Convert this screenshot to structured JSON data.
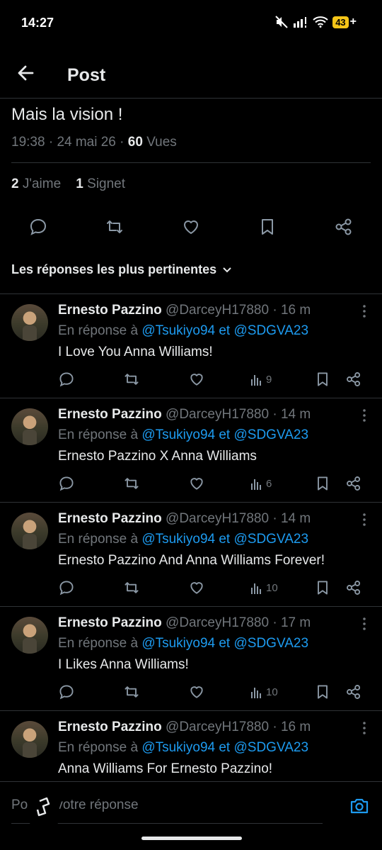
{
  "status_bar": {
    "time": "14:27",
    "battery": "43",
    "battery_plus": "+"
  },
  "header": {
    "title": "Post"
  },
  "post": {
    "text": "Mais la vision !",
    "time": "19:38",
    "date": "24 mai 26",
    "views_count": "60",
    "views_label": "Vues",
    "likes_count": "2",
    "likes_label": "J'aime",
    "bookmarks_count": "1",
    "bookmarks_label": "Signet"
  },
  "sort": {
    "label": "Les réponses les plus pertinentes"
  },
  "replies": [
    {
      "name": "Ernesto Pazzino",
      "handle": "@DarceyH17880",
      "time": "16 m",
      "reply_prefix": "En réponse à",
      "mentions": "@Tsukiyo94 et @SDGVA23",
      "text": "I Love You Anna Williams!",
      "views": "9"
    },
    {
      "name": "Ernesto Pazzino",
      "handle": "@DarceyH17880",
      "time": "14 m",
      "reply_prefix": "En réponse à",
      "mentions": "@Tsukiyo94 et @SDGVA23",
      "text": "Ernesto Pazzino X Anna Williams",
      "views": "6"
    },
    {
      "name": "Ernesto Pazzino",
      "handle": "@DarceyH17880",
      "time": "14 m",
      "reply_prefix": "En réponse à",
      "mentions": "@Tsukiyo94 et @SDGVA23",
      "text": "Ernesto Pazzino And Anna Williams Forever!",
      "views": "10"
    },
    {
      "name": "Ernesto Pazzino",
      "handle": "@DarceyH17880",
      "time": "17 m",
      "reply_prefix": "En réponse à",
      "mentions": "@Tsukiyo94 et @SDGVA23",
      "text": "I Likes Anna Williams!",
      "views": "10"
    },
    {
      "name": "Ernesto Pazzino",
      "handle": "@DarceyH17880",
      "time": "16 m",
      "reply_prefix": "En réponse à",
      "mentions": "@Tsukiyo94 et @SDGVA23",
      "text": "Anna Williams For Ernesto Pazzino!",
      "views": ""
    }
  ],
  "composer": {
    "placeholder": "Postez votre réponse"
  },
  "icons": {
    "back": "arrow-left-icon",
    "reply": "comment-icon",
    "repost": "repost-icon",
    "like": "heart-icon",
    "bookmark": "bookmark-icon",
    "share": "share-icon",
    "views": "bar-chart-icon",
    "more": "more-vertical-icon",
    "camera": "camera-icon",
    "sort": "chevron-down-icon"
  },
  "colors": {
    "background": "#000000",
    "text": "#e7e9ea",
    "secondary": "#71767b",
    "accent": "#1d9bf0",
    "divider": "#2f3336",
    "battery": "#f5c518"
  }
}
